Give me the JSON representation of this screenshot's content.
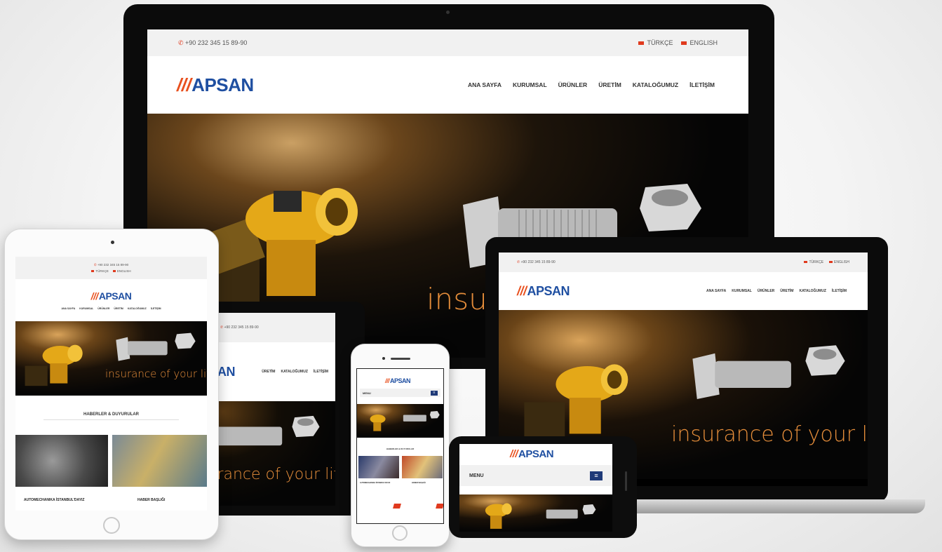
{
  "site": {
    "phone": "+90 232 345 15 89-90",
    "lang_tr": "TÜRKÇE",
    "lang_en": "ENGLISH",
    "logo_slashes": "///",
    "logo_text": "APSAN",
    "nav": [
      "ANA SAYFA",
      "KURUMSAL",
      "ÜRÜNLER",
      "ÜRETİM",
      "KATALOĞUMUZ",
      "İLETİŞİM"
    ],
    "tagline": "insurance of your life",
    "tagline_partial": "insu",
    "menu_label": "MENU",
    "news_heading": "HABERLER & DUYURULAR",
    "news_items": [
      "AUTOMECHANIKA İSTANBUL'DAYIZ",
      "HABER BAŞLIĞI"
    ],
    "nav_partial": [
      "ÜRETİM",
      "KATALOĞUMUZ",
      "İLETİŞİM"
    ],
    "logo_partial": "AN"
  },
  "colors": {
    "brand_blue": "#1f4fa1",
    "brand_orange": "#e8501e",
    "tagline_orange": "#e58d3a",
    "menu_button": "#1f3a78"
  }
}
